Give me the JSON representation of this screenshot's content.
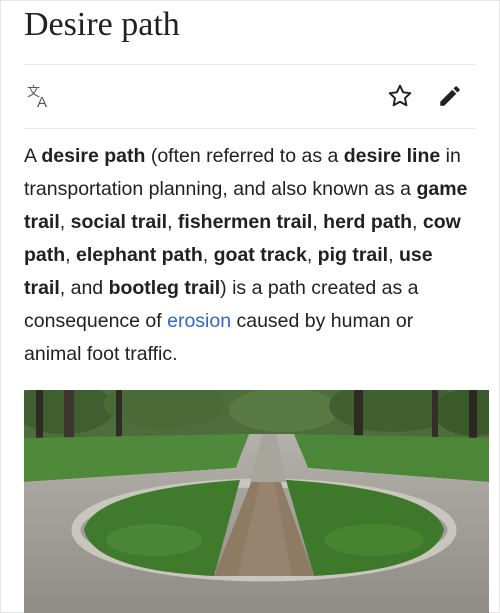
{
  "article": {
    "title": "Desire path",
    "toolbar": {
      "language_icon": "translate-icon",
      "watch_icon": "star-icon",
      "edit_icon": "pencil-icon"
    },
    "lead": [
      "A ",
      {
        "bold": "desire path"
      },
      " (often referred to as a ",
      {
        "bold": "desire line"
      },
      " in transportation planning, and also known as a ",
      {
        "bold": "game trail"
      },
      ", ",
      {
        "bold": "social trail"
      },
      ", ",
      {
        "bold": "fishermen trail"
      },
      ", ",
      {
        "bold": "herd path"
      },
      ", ",
      {
        "bold": "cow path"
      },
      ", ",
      {
        "bold": "elephant path"
      },
      ", ",
      {
        "bold": "goat track"
      },
      ", ",
      {
        "bold": "pig trail"
      },
      ", ",
      {
        "bold": "use trail"
      },
      ", and ",
      {
        "bold": "bootleg trail"
      },
      ") is a path created as a consequence of ",
      {
        "link": "erosion"
      },
      " caused by human or animal foot traffic."
    ],
    "image": {
      "subject": "park lawn with worn footpath cutting through circular grass bed"
    }
  },
  "colors": {
    "link": "#3366cc",
    "text": "#202122",
    "divider": "#e8e8e8"
  }
}
